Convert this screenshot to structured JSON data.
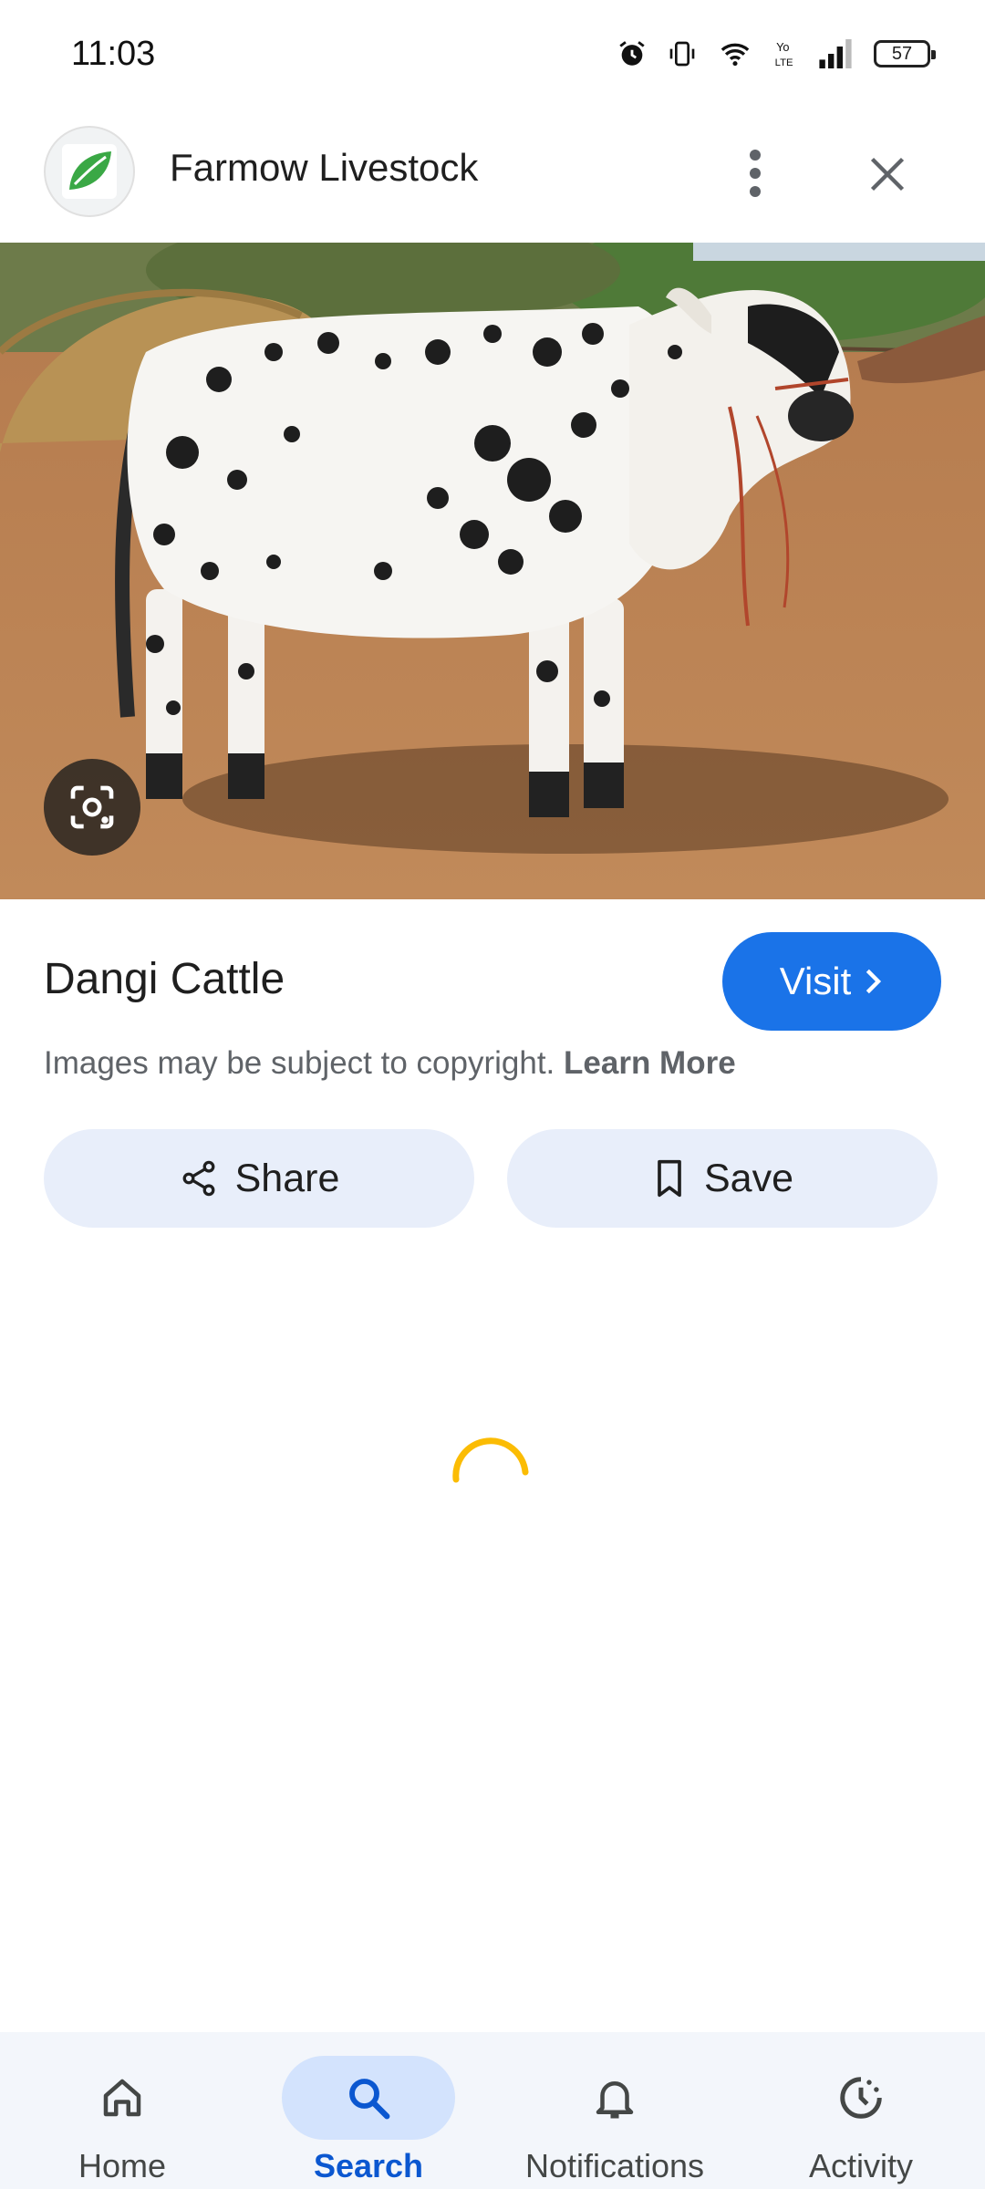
{
  "status_bar": {
    "time": "11:03",
    "battery": "57"
  },
  "header": {
    "site_name": "Farmow Livestock"
  },
  "result": {
    "title": "Dangi Cattle",
    "visit_label": "Visit",
    "copyright_text": "Images may be subject to copyright.",
    "learn_more": "Learn More",
    "share_label": "Share",
    "save_label": "Save"
  },
  "icons": {
    "more": "more-vert-icon",
    "close": "close-icon",
    "lens": "google-lens-icon",
    "share": "share-icon",
    "save": "bookmark-icon"
  },
  "colors": {
    "accent": "#1a73e8",
    "spinner": "#fbbc04",
    "nav_active": "#0b57d0"
  },
  "bottom_nav": {
    "items": [
      {
        "label": "Home",
        "icon": "home-icon",
        "active": false
      },
      {
        "label": "Search",
        "icon": "search-icon",
        "active": true
      },
      {
        "label": "Notifications",
        "icon": "bell-icon",
        "active": false
      },
      {
        "label": "Activity",
        "icon": "activity-icon",
        "active": false
      }
    ]
  }
}
